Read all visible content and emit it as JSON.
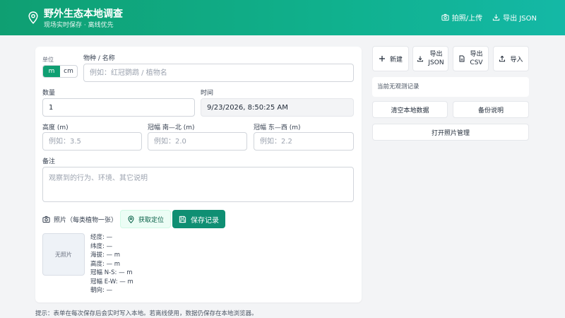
{
  "header": {
    "title": "野外生态本地调查",
    "subtitle": "现场实时保存 · 离线优先",
    "photo_upload": "拍照/上传",
    "export_json": "导出 JSON"
  },
  "form": {
    "unit_label": "单位",
    "unit_options": [
      "m",
      "cm"
    ],
    "unit_selected": "m",
    "species_label": "物种 / 名称",
    "species_placeholder": "例如：红冠鹦鹉 / 植物名",
    "count_label": "数量",
    "count_value": "1",
    "time_label": "时间",
    "time_value": "9/23/2026, 8:50:25 AM",
    "height_label": "高度 (m)",
    "height_placeholder": "例如：3.5",
    "crown_ns_label": "冠幅 南—北 (m)",
    "crown_ns_placeholder": "例如：2.0",
    "crown_ew_label": "冠幅 东—西 (m)",
    "crown_ew_placeholder": "例如：2.2",
    "notes_label": "备注",
    "notes_placeholder": "观察到的行为、环境、其它说明",
    "photo_label": "照片（每类植物一张）",
    "get_location": "获取定位",
    "save_record": "保存记录",
    "no_photo": "无照片",
    "meta": {
      "longitude": "经度: —",
      "latitude": "纬度: —",
      "altitude": "海拔: — m",
      "height": "高度: — m",
      "crown_ns": "冠幅 N-S: — m",
      "crown_ew": "冠幅 E-W: — m",
      "orientation": "朝向: —"
    }
  },
  "tip": "提示：表单在每次保存后会实时写入本地。若离线使用，数据仍保存在本地浏览器。",
  "toolbar": {
    "new": "新建",
    "export_json_1": "导出",
    "export_json_2": "JSON",
    "export_csv_1": "导出",
    "export_csv_2": "CSV",
    "import": "导入"
  },
  "status": "当前无观测记录",
  "actions": {
    "clear": "清空本地数据",
    "backup": "备份说明",
    "photo_manager": "打开照片管理"
  },
  "colors": {
    "brand": "#0f9f72",
    "save_button": "#0f8f73"
  }
}
